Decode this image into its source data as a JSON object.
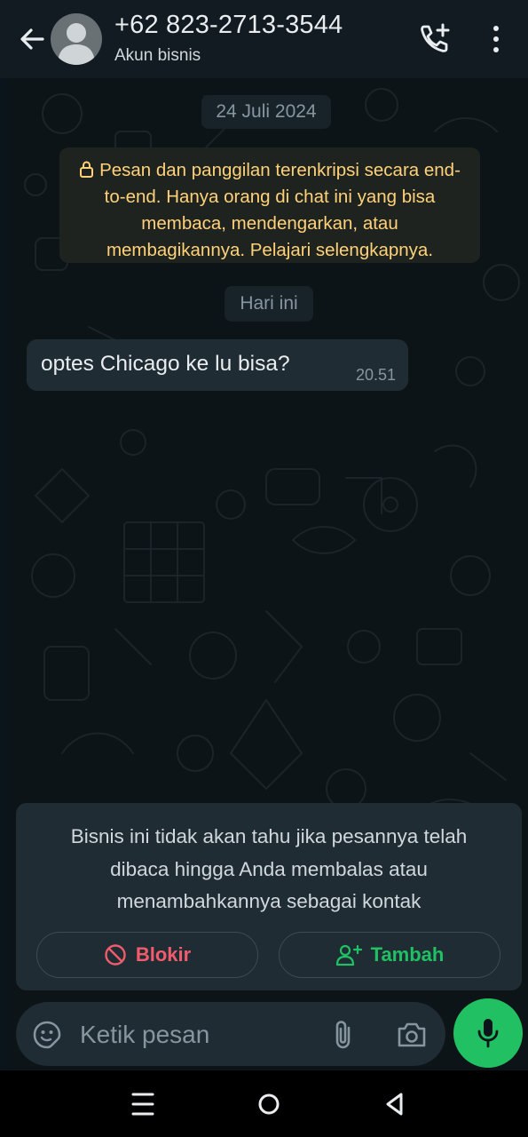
{
  "header": {
    "contact_name": "+62 823-2713-3544",
    "contact_subtitle": "Akun bisnis",
    "icons": [
      "back-arrow-icon",
      "avatar-placeholder-icon",
      "add-call-icon",
      "more-vertical-icon"
    ]
  },
  "chat": {
    "date_chip": "24 Juli 2024",
    "encryption_notice": "Pesan dan panggilan terenkripsi secara end-to-end. Hanya orang di chat ini yang bisa membaca, mendengarkan, atau membagikannya. Pelajari selengkapnya.",
    "today_chip": "Hari ini",
    "messages": [
      {
        "text": "optes Chicago ke lu bisa?",
        "time": "20.51",
        "direction": "incoming"
      }
    ]
  },
  "business_notice": {
    "text": "Bisnis ini tidak akan tahu jika pesannya telah dibaca hingga Anda membalas atau menambahkannya sebagai kontak",
    "block_label": "Blokir",
    "add_label": "Tambah"
  },
  "composer": {
    "placeholder": "Ketik pesan",
    "icons": [
      "sticker-icon",
      "attach-icon",
      "camera-icon",
      "mic-icon"
    ]
  },
  "colors": {
    "background": "#0b141a",
    "header": "#111b21",
    "accent_green": "#21c063",
    "block_red": "#f15c6d",
    "encryption_text": "#ffd279"
  }
}
